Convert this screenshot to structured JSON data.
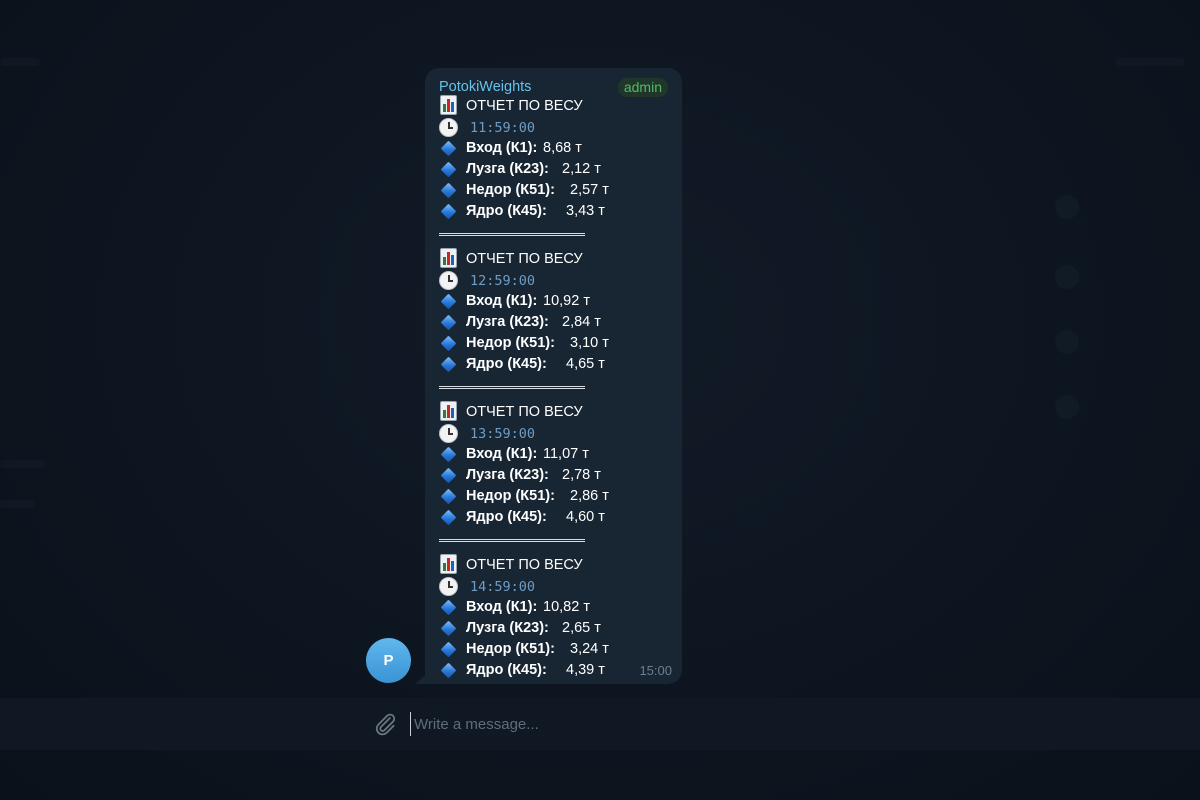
{
  "message": {
    "sender": "PotokiWeights",
    "badge": "admin",
    "time": "15:00",
    "avatar_letter": "P",
    "reports": [
      {
        "title": "ОТЧЕТ ПО ВЕСУ",
        "time": "11:59:00",
        "rows": [
          {
            "label": "Вход  (К1):",
            "value": "8,68 т"
          },
          {
            "label": "Лузга (К23):",
            "value": "2,12 т"
          },
          {
            "label": "Недор (К51):",
            "value": "2,57 т"
          },
          {
            "label": "Ядро  (К45):",
            "value": "3,43 т"
          }
        ]
      },
      {
        "title": "ОТЧЕТ ПО ВЕСУ",
        "time": "12:59:00",
        "rows": [
          {
            "label": "Вход  (К1):",
            "value": "10,92 т"
          },
          {
            "label": "Лузга (К23):",
            "value": "2,84 т"
          },
          {
            "label": "Недор (К51):",
            "value": "3,10 т"
          },
          {
            "label": "Ядро  (К45):",
            "value": "4,65 т"
          }
        ]
      },
      {
        "title": "ОТЧЕТ ПО ВЕСУ",
        "time": "13:59:00",
        "rows": [
          {
            "label": "Вход  (К1):",
            "value": "11,07 т"
          },
          {
            "label": "Лузга (К23):",
            "value": "2,78 т"
          },
          {
            "label": "Недор (К51):",
            "value": "2,86 т"
          },
          {
            "label": "Ядро  (К45):",
            "value": "4,60 т"
          }
        ]
      },
      {
        "title": "ОТЧЕТ ПО ВЕСУ",
        "time": "14:59:00",
        "rows": [
          {
            "label": "Вход  (К1):",
            "value": "10,82 т"
          },
          {
            "label": "Лузга (К23):",
            "value": "2,65 т"
          },
          {
            "label": "Недор (К51):",
            "value": "3,24 т"
          },
          {
            "label": "Ядро  (К45):",
            "value": "4,39 т"
          }
        ]
      }
    ]
  },
  "composer": {
    "placeholder": "Write a message...",
    "attach_icon": "paperclip-icon"
  },
  "icons": {
    "title": "bar-chart-icon",
    "time": "clock-icon",
    "row": "blue-diamond-icon"
  },
  "colors": {
    "background": "#0e1621",
    "bubble": "#182533",
    "sender": "#66c1ea",
    "badge": "#4fbd5e",
    "time_text": "#6f9dc4"
  }
}
